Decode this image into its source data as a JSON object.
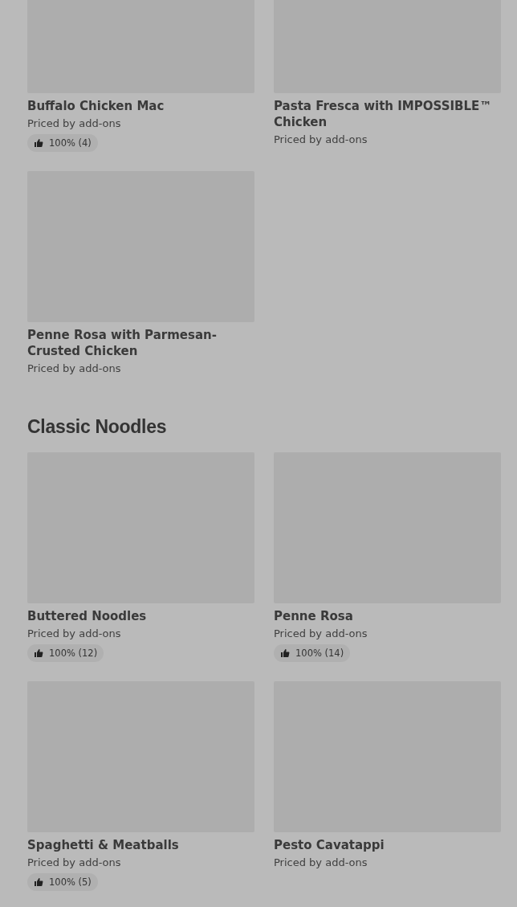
{
  "sections": [
    {
      "items": [
        {
          "name": "Buffalo Chicken Mac",
          "price": "Priced by add-ons",
          "rating": "100% (4)"
        },
        {
          "name": "Pasta Fresca with IMPOSSIBLE™ Chicken",
          "price": "Priced by add-ons"
        },
        {
          "name": "Penne Rosa with Parmesan-Crusted Chicken",
          "price": "Priced by add-ons"
        }
      ]
    },
    {
      "title": "Classic Noodles",
      "items": [
        {
          "name": "Buttered Noodles",
          "price": "Priced by add-ons",
          "rating": "100% (12)"
        },
        {
          "name": "Penne Rosa",
          "price": "Priced by add-ons",
          "rating": "100% (14)"
        },
        {
          "name": "Spaghetti & Meatballs",
          "price": "Priced by add-ons",
          "rating": "100% (5)"
        },
        {
          "name": "Pesto Cavatappi",
          "price": "Priced by add-ons"
        }
      ]
    }
  ]
}
